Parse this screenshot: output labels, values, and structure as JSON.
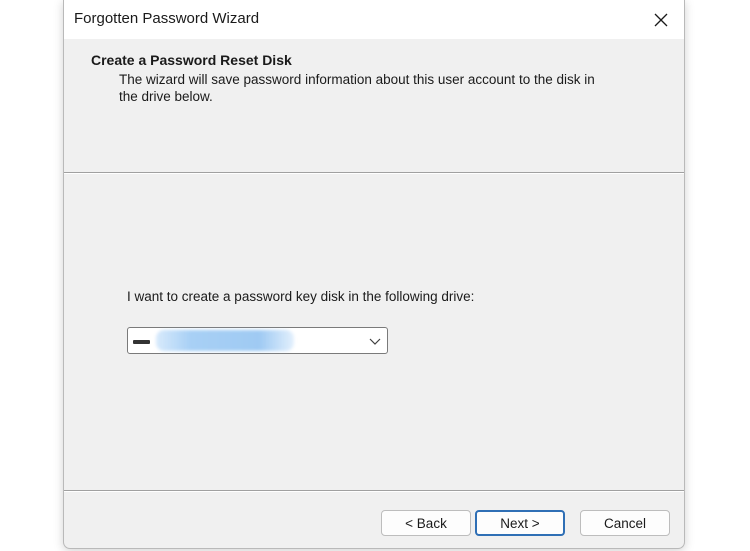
{
  "window": {
    "title": "Forgotten Password Wizard"
  },
  "header": {
    "title": "Create a Password Reset Disk",
    "description": "The wizard will save password information about this user account to the disk in the drive below."
  },
  "body": {
    "drive_label": "I want to create a password key disk in the following drive:",
    "drive_select": {
      "selected_value": "",
      "icon": "drive-icon"
    }
  },
  "footer": {
    "back_label": "< Back",
    "next_label": "Next >",
    "cancel_label": "Cancel"
  },
  "colors": {
    "window_bg": "#f0f0f0",
    "titlebar_bg": "#ffffff",
    "default_button_border": "#2f6fb5",
    "selection_highlight": "#a8d0f5"
  }
}
